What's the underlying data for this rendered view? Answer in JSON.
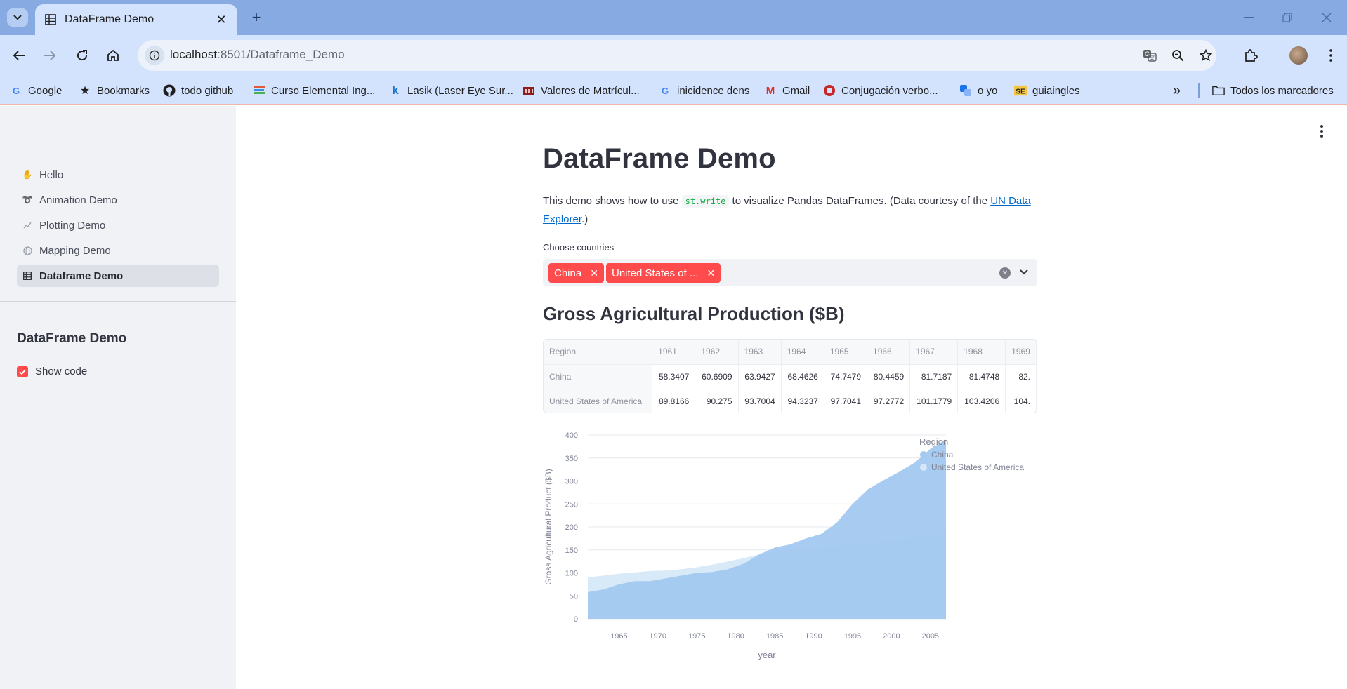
{
  "browser": {
    "tab_title": "DataFrame Demo",
    "url_host": "localhost",
    "url_path": ":8501/Dataframe_Demo",
    "bookmarks": [
      {
        "label": "Google",
        "icon": "google-icon"
      },
      {
        "label": "Bookmarks",
        "icon": "star-icon"
      },
      {
        "label": "todo github",
        "icon": "github-icon"
      },
      {
        "label": "Curso Elemental Ing...",
        "icon": "books-icon"
      },
      {
        "label": "Lasik (Laser Eye Sur...",
        "icon": "k-icon"
      },
      {
        "label": "Valores de Matrícul...",
        "icon": "building-icon"
      },
      {
        "label": "inicidence dens",
        "icon": "google-icon"
      },
      {
        "label": "Gmail",
        "icon": "gmail-icon"
      },
      {
        "label": "Conjugación verbo...",
        "icon": "red-circle-icon"
      },
      {
        "label": "o yo",
        "icon": "translate-icon"
      },
      {
        "label": "guiaingles",
        "icon": "se-icon"
      }
    ],
    "more_bookmarks": "»",
    "all_bookmarks": "Todos los marcadores"
  },
  "sidebar": {
    "nav": [
      {
        "label": "Hello",
        "icon": "wave-icon"
      },
      {
        "label": "Animation Demo",
        "icon": "animation-icon"
      },
      {
        "label": "Plotting Demo",
        "icon": "chart-line-icon"
      },
      {
        "label": "Mapping Demo",
        "icon": "globe-icon"
      },
      {
        "label": "Dataframe Demo",
        "icon": "table-icon"
      }
    ],
    "heading": "DataFrame Demo",
    "show_code_label": "Show code",
    "show_code_checked": true
  },
  "main": {
    "title": "DataFrame Demo",
    "desc_before": "This demo shows how to use ",
    "desc_code": "st.write",
    "desc_middle": " to visualize Pandas DataFrames. (Data courtesy of the ",
    "desc_link": "UN Data Explorer",
    "desc_after": ".)",
    "multiselect_label": "Choose countries",
    "chips": [
      "China",
      "United States of ..."
    ],
    "section_title": "Gross Agricultural Production ($B)",
    "table": {
      "columns": [
        "Region",
        "1961",
        "1962",
        "1963",
        "1964",
        "1965",
        "1966",
        "1967",
        "1968",
        "1969"
      ],
      "rows": [
        [
          "China",
          "58.3407",
          "60.6909",
          "63.9427",
          "68.4626",
          "74.7479",
          "80.4459",
          "81.7187",
          "81.4748",
          "82."
        ],
        [
          "United States of America",
          "89.8166",
          "90.275",
          "93.7004",
          "94.3237",
          "97.7041",
          "97.2772",
          "101.1779",
          "103.4206",
          "104."
        ]
      ]
    }
  },
  "accent_color": "#ff4b4b",
  "chart_data": {
    "type": "area",
    "xlabel": "year",
    "ylabel": "Gross Agricultural Product ($B)",
    "xlim": [
      1961,
      2007
    ],
    "ylim": [
      0,
      400
    ],
    "x_ticks": [
      1965,
      1970,
      1975,
      1980,
      1985,
      1990,
      1995,
      2000,
      2005
    ],
    "y_ticks": [
      0,
      50,
      100,
      150,
      200,
      250,
      300,
      350,
      400
    ],
    "grid": true,
    "legend_title": "Region",
    "legend_position": "right",
    "x": [
      1961,
      1963,
      1965,
      1967,
      1969,
      1971,
      1973,
      1975,
      1977,
      1979,
      1981,
      1983,
      1985,
      1987,
      1989,
      1991,
      1993,
      1995,
      1997,
      1999,
      2001,
      2003,
      2005,
      2007
    ],
    "series": [
      {
        "name": "China",
        "color": "#a3c9f0",
        "values": [
          58,
          64,
          75,
          82,
          82,
          88,
          94,
          100,
          102,
          108,
          120,
          140,
          155,
          162,
          175,
          185,
          210,
          250,
          282,
          302,
          320,
          340,
          370,
          390
        ]
      },
      {
        "name": "United States of America",
        "color": "#d6e8f8",
        "values": [
          90,
          94,
          98,
          101,
          104,
          105,
          108,
          112,
          118,
          125,
          132,
          140,
          145,
          150,
          152,
          155,
          158,
          162,
          168,
          170,
          172,
          176,
          180,
          182
        ]
      }
    ]
  }
}
